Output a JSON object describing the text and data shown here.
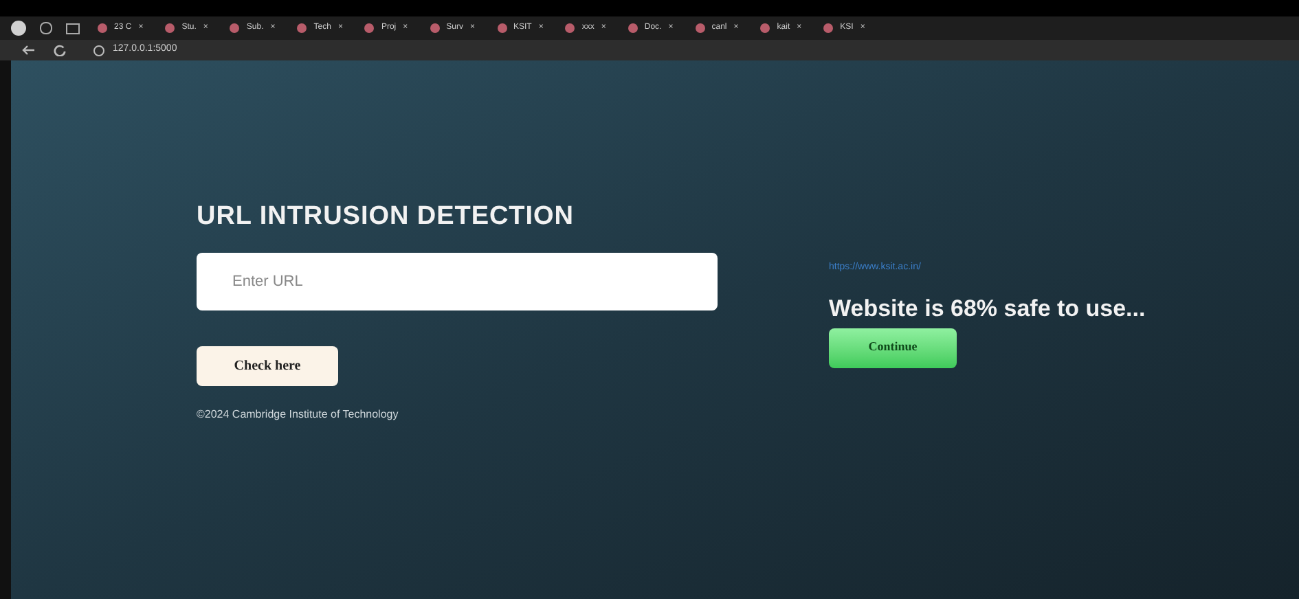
{
  "browser": {
    "tabs": [
      {
        "label": "23 C"
      },
      {
        "label": "Stu."
      },
      {
        "label": "Sub."
      },
      {
        "label": "Tech"
      },
      {
        "label": "Proj"
      },
      {
        "label": "Surv"
      },
      {
        "label": "KSIT"
      },
      {
        "label": "xxx"
      },
      {
        "label": "Doc."
      },
      {
        "label": "canl"
      },
      {
        "label": "kait"
      },
      {
        "label": "KSI"
      }
    ],
    "close_glyph": "×",
    "address": "127.0.0.1:5000"
  },
  "form": {
    "title": "URL INTRUSION DETECTION",
    "url_field": {
      "placeholder": "Enter URL"
    },
    "button": "Check here",
    "footer": "©2024 Cambridge Institute of Technology"
  },
  "result": {
    "url": "https://www.ksit.ac.in/",
    "message": "Website is 68% safe to use...",
    "button": "Continue"
  }
}
